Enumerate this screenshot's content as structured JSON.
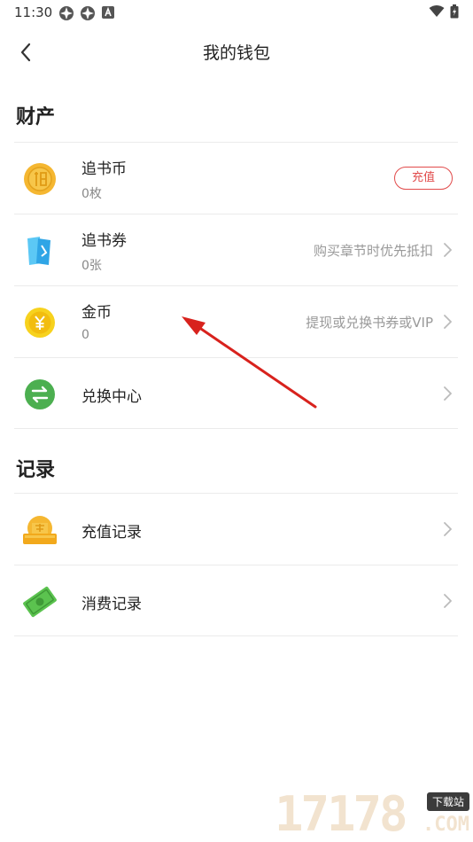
{
  "status_bar": {
    "time": "11:30",
    "icons": [
      "notification-app-icon",
      "notification-app-icon",
      "a-letter-icon"
    ],
    "right_icons": [
      "wifi-icon",
      "battery-icon"
    ]
  },
  "nav": {
    "title": "我的钱包",
    "back_icon": "chevron-left-icon"
  },
  "sections": {
    "assets": {
      "heading": "财产"
    },
    "records": {
      "heading": "记录"
    }
  },
  "assets_items": [
    {
      "title": "追书币",
      "sub": "0枚",
      "action": "充值",
      "icon": "coin-icon"
    },
    {
      "title": "追书券",
      "sub": "0张",
      "hint": "购买章节时优先抵扣",
      "icon": "ticket-icon"
    },
    {
      "title": "金币",
      "sub": "0",
      "hint": "提现或兑换书券或VIP",
      "icon": "gold-coin-icon"
    },
    {
      "title": "兑换中心",
      "icon": "exchange-icon"
    }
  ],
  "record_items": [
    {
      "title": "充值记录",
      "icon": "recharge-record-icon"
    },
    {
      "title": "消费记录",
      "icon": "money-icon"
    }
  ],
  "colors": {
    "accent_red": "#e14b4b",
    "coin_gold": "#f5b731",
    "coin_yellow": "#f7d21e",
    "ticket_blue": "#3db6f0",
    "exchange_green": "#4caf50",
    "money_green": "#5bc34f",
    "annotation_arrow": "#d8221d"
  },
  "watermark": {
    "digits": "17178",
    "badge": "下载站",
    "suffix": ".COM"
  }
}
